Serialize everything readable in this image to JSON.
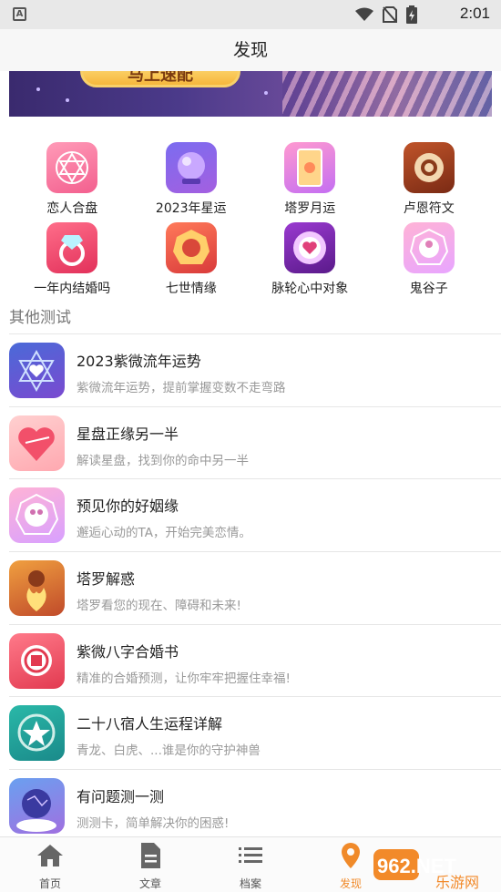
{
  "status_bar": {
    "time": "2:01",
    "left_icon": "A"
  },
  "header": {
    "title": "发现"
  },
  "banner": {
    "button_text": "马上速配"
  },
  "grid": [
    {
      "label": "恋人合盘",
      "icon": "hexagram-icon"
    },
    {
      "label": "2023年星运",
      "icon": "crystal-ball-icon"
    },
    {
      "label": "塔罗月运",
      "icon": "tarot-card-icon"
    },
    {
      "label": "卢恩符文",
      "icon": "rune-sun-icon"
    },
    {
      "label": "一年内结婚吗",
      "icon": "diamond-ring-icon"
    },
    {
      "label": "七世情缘",
      "icon": "bagua-couple-icon"
    },
    {
      "label": "脉轮心中对象",
      "icon": "chakra-heart-icon"
    },
    {
      "label": "鬼谷子",
      "icon": "bagua-figure-icon"
    }
  ],
  "section_title": "其他测试",
  "list": [
    {
      "title": "2023紫微流年运势",
      "desc": "紫微流年运势，提前掌握变数不走弯路"
    },
    {
      "title": "星盘正缘另一半",
      "desc": "解读星盘，找到你的命中另一半"
    },
    {
      "title": "预见你的好姻缘",
      "desc": "邂逅心动的TA，开始完美恋情。"
    },
    {
      "title": "塔罗解惑",
      "desc": "塔罗看您的现在、障碍和未来!"
    },
    {
      "title": "紫微八字合婚书",
      "desc": "精准的合婚预测，让你牢牢把握住幸福!"
    },
    {
      "title": "二十八宿人生运程详解",
      "desc": "青龙、白虎、...谁是你的守护神兽"
    },
    {
      "title": "有问题测一测",
      "desc": "测测卡，简单解决你的困惑!"
    }
  ],
  "bottom_nav": [
    {
      "label": "首页",
      "icon": "home-icon"
    },
    {
      "label": "文章",
      "icon": "document-icon"
    },
    {
      "label": "档案",
      "icon": "list-icon"
    },
    {
      "label": "发现",
      "icon": "location-pin-icon",
      "active": true
    }
  ],
  "watermark": {
    "text": "962.NET",
    "subtext": "乐游网"
  },
  "colors": {
    "accent": "#f08a2a",
    "text_secondary": "#999999"
  }
}
